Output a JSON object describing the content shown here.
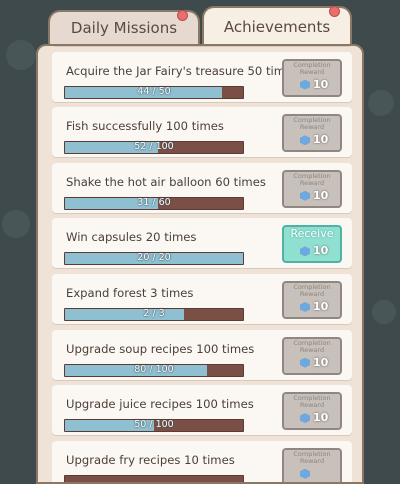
{
  "tabs": {
    "daily": "Daily Missions",
    "achievements": "Achievements"
  },
  "achievements": [
    {
      "title": "Acquire the Jar Fairy's treasure 50 times",
      "progress": "44 / 50",
      "fill": 0.88,
      "reward_label": "Completion Reward",
      "reward_count": "10",
      "status": "locked"
    },
    {
      "title": "Fish successfully 100 times",
      "progress": "52 / 100",
      "fill": 0.52,
      "reward_label": "Completion Reward",
      "reward_count": "10",
      "status": "locked"
    },
    {
      "title": "Shake the hot air balloon 60 times",
      "progress": "31 / 60",
      "fill": 0.52,
      "reward_label": "Completion Reward",
      "reward_count": "10",
      "status": "locked"
    },
    {
      "title": "Win capsules 20 times",
      "progress": "20 / 20",
      "fill": 1.0,
      "reward_label": "Receive",
      "reward_count": "10",
      "status": "receive"
    },
    {
      "title": "Expand forest 3 times",
      "progress": "2 / 3",
      "fill": 0.67,
      "reward_label": "Completion Reward",
      "reward_count": "10",
      "status": "locked"
    },
    {
      "title": "Upgrade soup recipes 100 times",
      "progress": "80 / 100",
      "fill": 0.8,
      "reward_label": "Completion Reward",
      "reward_count": "10",
      "status": "locked"
    },
    {
      "title": "Upgrade juice recipes 100 times",
      "progress": "50 / 100",
      "fill": 0.5,
      "reward_label": "Completion Reward",
      "reward_count": "10",
      "status": "locked"
    },
    {
      "title": "Upgrade fry recipes 10 times",
      "progress": "",
      "fill": 0.0,
      "reward_label": "Completion Reward",
      "reward_count": "",
      "status": "locked"
    }
  ]
}
